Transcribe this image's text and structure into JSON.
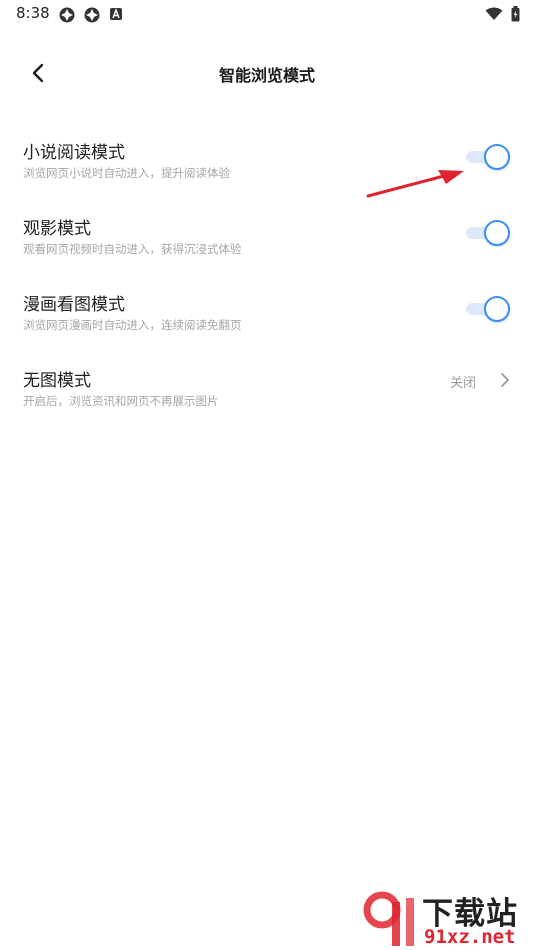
{
  "status_bar": {
    "time": "8:38"
  },
  "header": {
    "title": "智能浏览模式"
  },
  "settings": [
    {
      "title": "小说阅读模式",
      "description": "浏览网页小说时自动进入，提升阅读体验",
      "enabled": true
    },
    {
      "title": "观影模式",
      "description": "观看网页视频时自动进入，获得沉浸式体验",
      "enabled": true
    },
    {
      "title": "漫画看图模式",
      "description": "浏览网页漫画时自动进入，连续阅读免翻页",
      "enabled": true
    },
    {
      "title": "无图模式",
      "description": "开启后，浏览资讯和网页不再展示图片",
      "value": "关闭"
    }
  ],
  "colors": {
    "accent": "#3e8ef2",
    "toggle_track": "#dde8fb",
    "annotation_arrow": "#e0242e"
  },
  "watermark": {
    "brand": "下载站",
    "domain": "91xz.net"
  }
}
